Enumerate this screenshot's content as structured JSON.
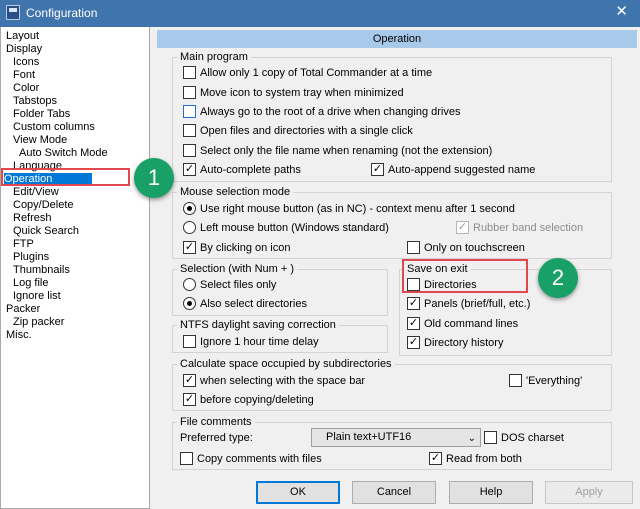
{
  "window": {
    "title": "Configuration",
    "close_glyph": "✕"
  },
  "tree": [
    {
      "label": "Layout"
    },
    {
      "label": "Display"
    },
    {
      "label": "Icons"
    },
    {
      "label": "Font"
    },
    {
      "label": "Color"
    },
    {
      "label": "Tabstops"
    },
    {
      "label": "Folder Tabs"
    },
    {
      "label": "Custom columns"
    },
    {
      "label": "View Mode"
    },
    {
      "label": "Auto Switch Mode"
    },
    {
      "label": "Language"
    },
    {
      "label": "Operation"
    },
    {
      "label": "Edit/View"
    },
    {
      "label": "Copy/Delete"
    },
    {
      "label": "Refresh"
    },
    {
      "label": "Quick Search"
    },
    {
      "label": "FTP"
    },
    {
      "label": "Plugins"
    },
    {
      "label": "Thumbnails"
    },
    {
      "label": "Log file"
    },
    {
      "label": "Ignore list"
    },
    {
      "label": "Packer"
    },
    {
      "label": "Zip packer"
    },
    {
      "label": "Misc."
    }
  ],
  "page_title": "Operation",
  "main_program": {
    "title": "Main program",
    "options": [
      {
        "label": "Allow only 1 copy of Total Commander at a time",
        "checked": false
      },
      {
        "label": "Move icon to system tray when minimized",
        "checked": false
      },
      {
        "label": "Always go to the root of a drive when changing drives",
        "checked": false
      },
      {
        "label": "Open files and directories with a single click",
        "checked": false
      },
      {
        "label": "Select only the file name when renaming (not the extension)",
        "checked": false
      },
      {
        "label": "Auto-complete paths",
        "checked": true
      },
      {
        "label": "Auto-append suggested name",
        "checked": true
      }
    ]
  },
  "mouse": {
    "title": "Mouse selection mode",
    "right": "Use right mouse button (as in NC) - context menu after 1 second",
    "left": "Left mouse button (Windows standard)",
    "rubber": "Rubber band selection",
    "by_icon": "By clicking on icon",
    "touch": "Only on touchscreen"
  },
  "selection": {
    "title": "Selection (with Num + )",
    "files_only": "Select files only",
    "also_dirs": "Also select directories"
  },
  "save_exit": {
    "title": "Save on exit",
    "options": [
      {
        "label": "Directories",
        "checked": false
      },
      {
        "label": "Panels (brief/full, etc.)",
        "checked": true
      },
      {
        "label": "Old command lines",
        "checked": true
      },
      {
        "label": "Directory history",
        "checked": true
      }
    ]
  },
  "ntfs": {
    "title": "NTFS daylight saving correction",
    "ignore": "Ignore 1 hour time delay"
  },
  "calc": {
    "title": "Calculate space occupied by subdirectories",
    "space_bar": "when selecting with the space bar",
    "before_copy": "before copying/deleting",
    "everything": "'Everything'"
  },
  "comments": {
    "title": "File comments",
    "preferred_label": "Preferred type:",
    "preferred_value": "Plain text+UTF16",
    "dos_charset": "DOS charset",
    "copy_comments": "Copy comments with files",
    "read_both": "Read from both"
  },
  "buttons": {
    "ok": "OK",
    "cancel": "Cancel",
    "help": "Help",
    "apply": "Apply"
  },
  "callouts": {
    "one": "1",
    "two": "2"
  },
  "check_glyph": "✓",
  "arrow_glyph": "⌄"
}
